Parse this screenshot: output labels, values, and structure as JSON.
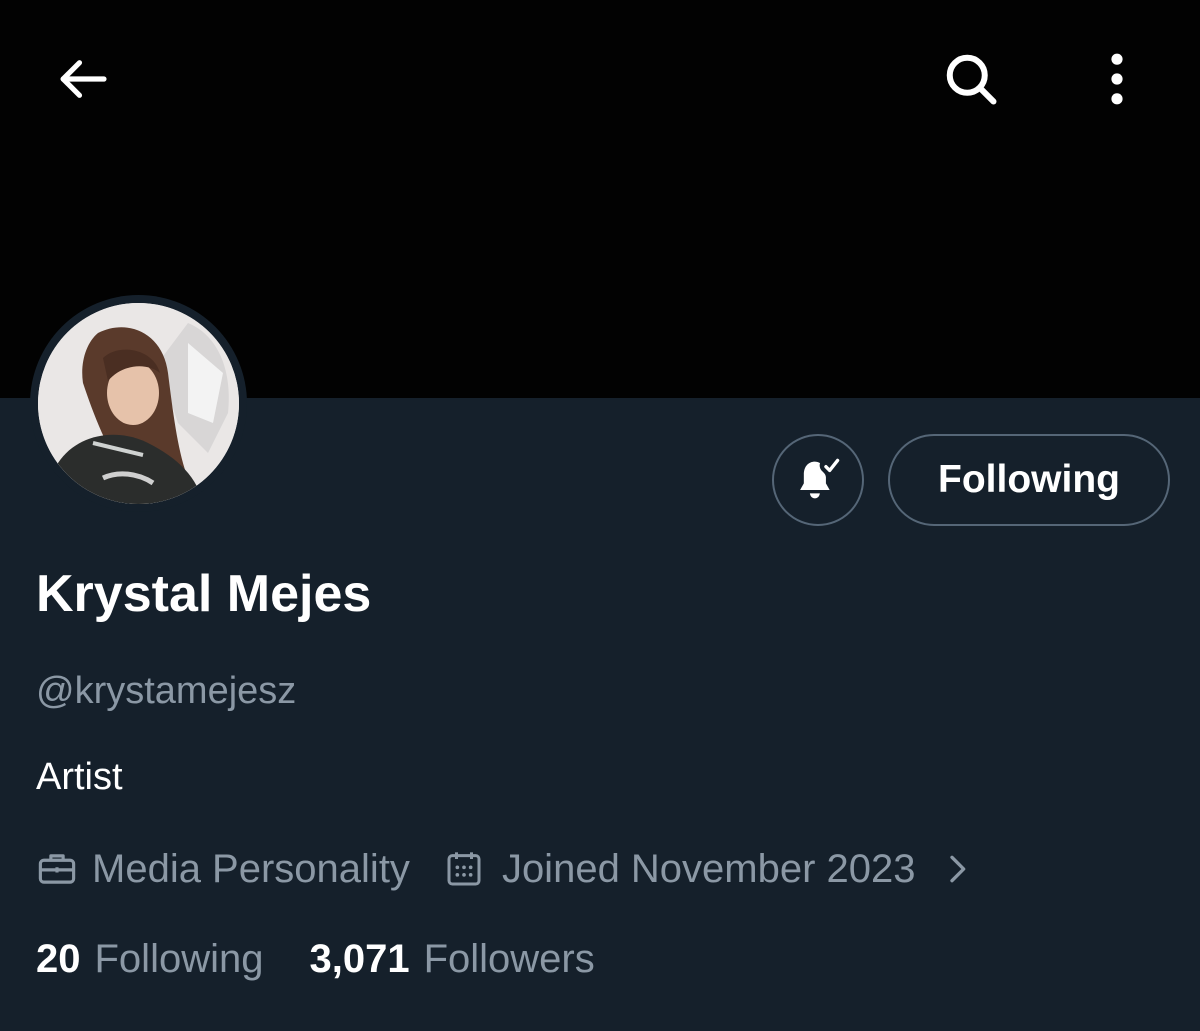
{
  "header": {
    "back_icon": "arrow-left-icon",
    "search_icon": "search-icon",
    "more_icon": "more-vertical-icon"
  },
  "profile": {
    "display_name": "Krystal Mejes",
    "handle": "@krystamejesz",
    "bio": "Artist",
    "category": "Media Personality",
    "category_icon": "briefcase-icon",
    "joined": "Joined November 2023",
    "joined_icon": "calendar-icon"
  },
  "actions": {
    "notify_icon": "bell-check-icon",
    "follow_label": "Following"
  },
  "stats": {
    "following_count": "20",
    "following_label": "Following",
    "followers_count": "3,071",
    "followers_label": "Followers"
  },
  "colors": {
    "background": "#15202b",
    "banner": "#020202",
    "secondary_text": "#8b98a5",
    "border": "#556677"
  }
}
